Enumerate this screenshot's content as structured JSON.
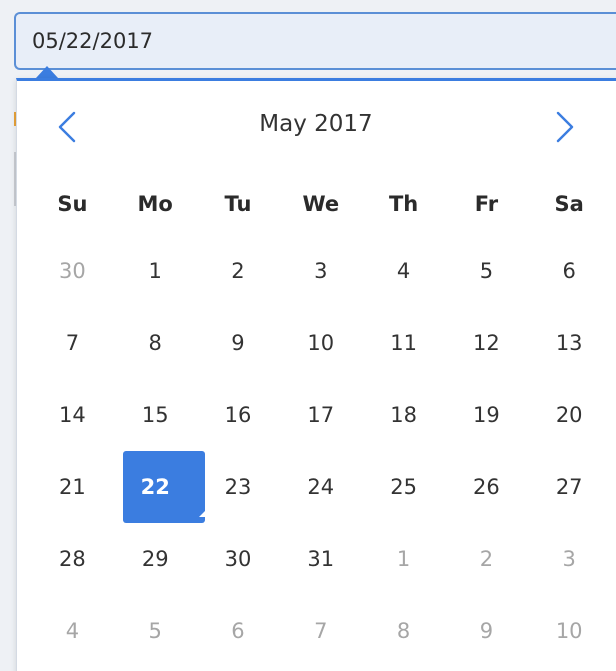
{
  "date_input": {
    "value": "05/22/2017"
  },
  "calendar": {
    "month_title": "May 2017",
    "accent_color": "#3b7de0",
    "prev_icon": "chevron-left-icon",
    "next_icon": "chevron-right-icon",
    "weekdays": [
      "Su",
      "Mo",
      "Tu",
      "We",
      "Th",
      "Fr",
      "Sa"
    ],
    "weeks": [
      [
        {
          "d": "30",
          "muted": true
        },
        {
          "d": "1"
        },
        {
          "d": "2"
        },
        {
          "d": "3"
        },
        {
          "d": "4"
        },
        {
          "d": "5"
        },
        {
          "d": "6"
        }
      ],
      [
        {
          "d": "7"
        },
        {
          "d": "8"
        },
        {
          "d": "9"
        },
        {
          "d": "10"
        },
        {
          "d": "11"
        },
        {
          "d": "12"
        },
        {
          "d": "13"
        }
      ],
      [
        {
          "d": "14"
        },
        {
          "d": "15"
        },
        {
          "d": "16"
        },
        {
          "d": "17"
        },
        {
          "d": "18"
        },
        {
          "d": "19"
        },
        {
          "d": "20"
        }
      ],
      [
        {
          "d": "21"
        },
        {
          "d": "22",
          "selected": true
        },
        {
          "d": "23"
        },
        {
          "d": "24"
        },
        {
          "d": "25"
        },
        {
          "d": "26"
        },
        {
          "d": "27"
        }
      ],
      [
        {
          "d": "28"
        },
        {
          "d": "29"
        },
        {
          "d": "30"
        },
        {
          "d": "31"
        },
        {
          "d": "1",
          "muted": true
        },
        {
          "d": "2",
          "muted": true
        },
        {
          "d": "3",
          "muted": true
        }
      ],
      [
        {
          "d": "4",
          "muted": true
        },
        {
          "d": "5",
          "muted": true
        },
        {
          "d": "6",
          "muted": true
        },
        {
          "d": "7",
          "muted": true
        },
        {
          "d": "8",
          "muted": true
        },
        {
          "d": "9",
          "muted": true
        },
        {
          "d": "10",
          "muted": true
        }
      ]
    ]
  }
}
